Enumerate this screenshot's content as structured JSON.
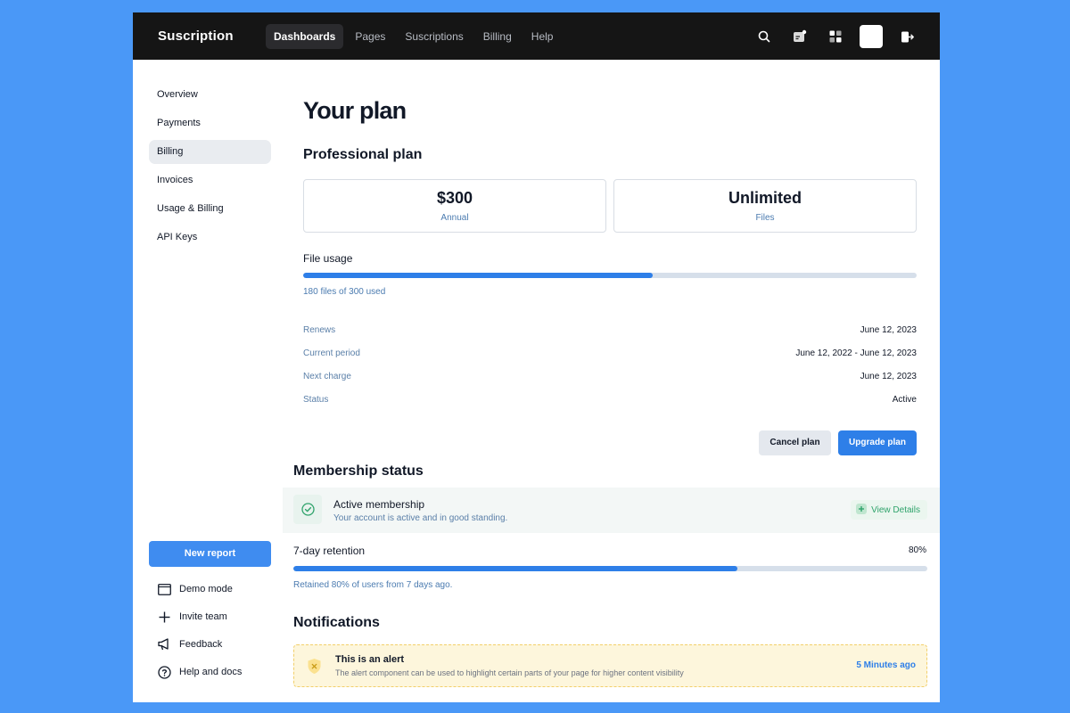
{
  "app": {
    "brand": "Suscription"
  },
  "nav": {
    "items": [
      {
        "label": "Dashboards",
        "active": true
      },
      {
        "label": "Pages"
      },
      {
        "label": "Suscriptions"
      },
      {
        "label": "Billing"
      },
      {
        "label": "Help"
      }
    ]
  },
  "top_icons": [
    "search-icon",
    "notification-icon",
    "apps-grid-icon",
    "avatar",
    "logout-icon"
  ],
  "sidebar": {
    "items": [
      {
        "label": "Overview"
      },
      {
        "label": "Payments"
      },
      {
        "label": "Billing",
        "active": true
      },
      {
        "label": "Invoices"
      },
      {
        "label": "Usage & Billing"
      },
      {
        "label": "API Keys"
      }
    ],
    "new_report": "New report",
    "bottom": [
      {
        "label": "Demo mode",
        "icon": "monitor-icon"
      },
      {
        "label": "Invite team",
        "icon": "plus-icon"
      },
      {
        "label": "Feedback",
        "icon": "megaphone-icon"
      },
      {
        "label": "Help and docs",
        "icon": "help-circle-icon"
      }
    ]
  },
  "page": {
    "title": "Your plan"
  },
  "plan": {
    "name": "Professional plan",
    "price": {
      "value": "$300",
      "sub": "Annual"
    },
    "files": {
      "value": "Unlimited",
      "sub": "Files"
    },
    "usage_label": "File usage",
    "usage_fraction": 0.57,
    "usage_text": "180 files of 300 used",
    "details": [
      {
        "key": "Renews",
        "value": "June 12, 2023"
      },
      {
        "key": "Current period",
        "value": "June 12, 2022 - June 12, 2023"
      },
      {
        "key": "Next charge",
        "value": "June 12, 2023"
      },
      {
        "key": "Status",
        "value": "Active"
      }
    ],
    "cancel_label": "Cancel plan",
    "upgrade_label": "Upgrade plan"
  },
  "membership": {
    "heading": "Membership status",
    "title": "Active membership",
    "subtitle": "Your account is active and in good standing.",
    "view_details": "View Details",
    "retention_label": "7-day retention",
    "retention_percent": "80%",
    "retention_fraction": 0.7,
    "retention_text": "Retained 80% of users from 7 days ago."
  },
  "notifications": {
    "heading": "Notifications",
    "alert_title": "This is an alert",
    "alert_body": "The alert component can be used to highlight certain parts of your page for higher content visibility",
    "alert_time": "5 Minutes ago"
  },
  "colors": {
    "background": "#4a98f7",
    "topbar": "#151515",
    "accent": "#2e7fe8",
    "success": "#2fa36b",
    "alert_bg": "#fdf6dc"
  }
}
